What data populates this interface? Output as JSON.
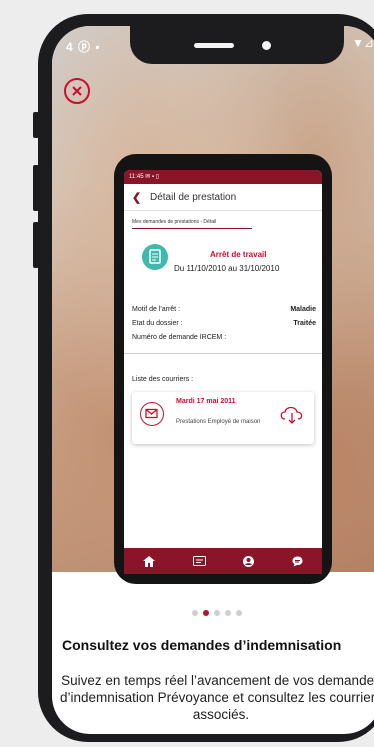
{
  "status_bar": {
    "left": "4 ⓟ ▪",
    "right": "▼⊿"
  },
  "inner_app": {
    "status": "11:45  ✉ ▪ ▯",
    "header_title": "Détail de prestation",
    "breadcrumb": "Mes demandes de prestations - Détail",
    "arret_title": "Arrêt de travail",
    "dates": "Du 11/10/2010 au 31/10/2010",
    "fields": [
      {
        "label": "Motif de l'arrêt :",
        "value": "Maladie"
      },
      {
        "label": "Etat du dossier :",
        "value": "Traitée"
      },
      {
        "label": "Numéro de demande IRCEM :",
        "value": ""
      }
    ],
    "courriers_label": "Liste des courriers :",
    "courrier": {
      "date": "Mardi 17 mai 2011",
      "description": "Prestations Employé de maison"
    }
  },
  "pagination": {
    "total": 5,
    "active_index": 1
  },
  "title": "Consultez vos demandes d’indemnisation",
  "body": "Suivez en temps réel l’avancement de vos demandes d’indemnisation Prévoyance et consultez les courriers associés.",
  "colors": {
    "accent": "#c8102e",
    "brand": "#8a1428",
    "teal": "#3fb9ad"
  },
  "icons": [
    "close-icon",
    "document-icon",
    "mail-icon",
    "cloud-download-icon",
    "home-icon",
    "card-icon",
    "user-icon",
    "chat-icon"
  ]
}
